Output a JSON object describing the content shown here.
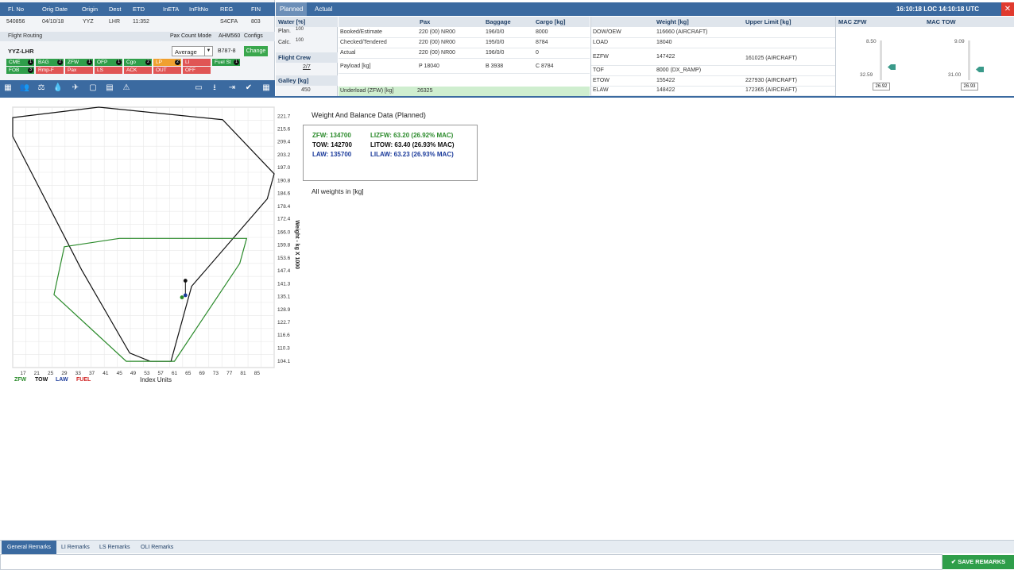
{
  "flight": {
    "headers": [
      "Fl. No",
      "Orig Date",
      "Origin",
      "Dest",
      "ETD",
      "InETA",
      "InFltNo",
      "REG",
      "FIN"
    ],
    "values": [
      "540856",
      "04/10/18",
      "YYZ",
      "LHR",
      "11:352",
      "",
      "",
      "S4CFA",
      "803"
    ],
    "routing_label": "Flight Routing",
    "pax_count_mode_label": "Pax Count Mode",
    "ahm_label": "AHM560",
    "configs_label": "Configs",
    "route": "YYZ-LHR",
    "pax_count_mode": "Average",
    "aircraft_type": "B787-8",
    "change_label": "Change"
  },
  "status_tags": [
    {
      "label": "CME",
      "num": "1",
      "color": "#2f9e4a"
    },
    {
      "label": "BAG",
      "num": "2",
      "color": "#2f9e4a"
    },
    {
      "label": "ZFW",
      "num": "1",
      "color": "#2f9e4a"
    },
    {
      "label": "OFP",
      "num": "1",
      "color": "#2f9e4a"
    },
    {
      "label": "Cgo",
      "num": "2",
      "color": "#2f9e4a"
    },
    {
      "label": "LP",
      "num": "2",
      "color": "#f0a030"
    },
    {
      "label": "LI",
      "num": "",
      "color": "#e05555"
    },
    {
      "label": "Fuel St",
      "num": "1",
      "color": "#2f9e4a"
    },
    {
      "label": "FOB",
      "num": "3",
      "color": "#2f9e4a"
    },
    {
      "label": "Rmp-F",
      "num": "",
      "color": "#e05555"
    },
    {
      "label": "Pax",
      "num": "",
      "color": "#e05555"
    },
    {
      "label": "LS",
      "num": "",
      "color": "#e05555"
    },
    {
      "label": "ACK",
      "num": "",
      "color": "#e05555"
    },
    {
      "label": "OUT",
      "num": "",
      "color": "#e05555"
    },
    {
      "label": "OFF",
      "num": "",
      "color": "#e05555"
    }
  ],
  "toolbar_icons": [
    "grid-icon",
    "users-icon",
    "scale-icon",
    "fuel-drop-icon",
    "plane-circle-icon",
    "cargo-icon",
    "table-icon",
    "trim-icon",
    "document-icon",
    "download-icon",
    "doc-out-icon",
    "checkmark-icon",
    "calculator-icon"
  ],
  "tabs": {
    "planned": "Planned",
    "actual": "Actual"
  },
  "clock": "16:10:18 LOC 14:10:18 UTC",
  "water": {
    "header": "Water [%]",
    "plan_label": "Plan.",
    "plan_value": "100",
    "calc_label": "Calc.",
    "calc_value": "100",
    "crew_header": "Flight Crew",
    "crew_value": "2/7",
    "galley_header": "Galley [kg]",
    "galley_value": "450"
  },
  "load_table": {
    "headers": [
      "Pax",
      "Baggage",
      "Cargo [kg]"
    ],
    "rows": [
      {
        "label": "Booked/Estimate",
        "pax": "220 (00) NR00",
        "bag": "196/0/0",
        "cargo": "8000"
      },
      {
        "label": "Checked/Tendered",
        "pax": "220 (00) NR00",
        "bag": "195/0/0",
        "cargo": "8784"
      },
      {
        "label": "Actual",
        "pax": "220 (00) NR00",
        "bag": "196/0/0",
        "cargo": "0"
      },
      {
        "label": "Payload [kg]",
        "pax": "P 18040",
        "bag": "B 3938",
        "cargo": "C 8784"
      }
    ],
    "underload_label": "Underload (ZFW) [kg]",
    "underload_value": "26325"
  },
  "weight_table": {
    "headers": [
      "Weight [kg]",
      "Upper Limit [kg]"
    ],
    "rows": [
      {
        "label": "DOW/OEW",
        "weight": "116660 (AIRCRAFT)",
        "limit": ""
      },
      {
        "label": "LOAD",
        "weight": "18040",
        "limit": ""
      },
      {
        "label": "EZFW",
        "weight": "147422",
        "limit": "161025 (AIRCRAFT)"
      },
      {
        "label": "TOF",
        "weight": "8000 (DX_RAMP)",
        "limit": ""
      },
      {
        "label": "ETOW",
        "weight": "155422",
        "limit": "227930 (AIRCRAFT)"
      },
      {
        "label": "ELAW",
        "weight": "148422",
        "limit": "172365 (AIRCRAFT)"
      }
    ]
  },
  "mac": {
    "zfw": {
      "title": "MAC ZFW",
      "upper": "8.50",
      "lower": "32.59",
      "value": "26.92"
    },
    "tow": {
      "title": "MAC TOW",
      "upper": "9.09",
      "lower": "31.00",
      "value": "26.93"
    }
  },
  "chart_data": {
    "type": "scatter",
    "xlabel": "Index Units",
    "ylabel": "Weight - kg X 1000",
    "x_ticks": [
      17,
      21,
      25,
      29,
      33,
      37,
      41,
      45,
      49,
      53,
      57,
      61,
      65,
      69,
      73,
      77,
      81,
      85
    ],
    "y_ticks": [
      104.1,
      110.3,
      116.6,
      122.7,
      128.9,
      135.1,
      141.3,
      147.4,
      153.6,
      159.8,
      166.0,
      172.4,
      178.4,
      184.6,
      190.8,
      197.0,
      203.2,
      209.4,
      215.6,
      221.7
    ],
    "xlim": [
      14,
      90
    ],
    "ylim": [
      101,
      226
    ],
    "envelopes": [
      {
        "name": "TOW",
        "color": "#111111",
        "points": [
          [
            14,
            221
          ],
          [
            39,
            226
          ],
          [
            75,
            220
          ],
          [
            90,
            194
          ],
          [
            88,
            182
          ],
          [
            66,
            140
          ],
          [
            60,
            104
          ],
          [
            54,
            104
          ],
          [
            48,
            108
          ],
          [
            34,
            148
          ],
          [
            14,
            212
          ]
        ]
      },
      {
        "name": "ZFW",
        "color": "#2a8a2a",
        "points": [
          [
            29,
            159
          ],
          [
            45,
            163
          ],
          [
            82,
            163
          ],
          [
            80,
            151
          ],
          [
            61,
            104
          ],
          [
            47,
            104
          ],
          [
            26,
            136
          ],
          [
            29,
            159
          ]
        ]
      }
    ],
    "points": [
      {
        "name": "TOW",
        "x": 64.2,
        "y": 142.7,
        "color": "#111111"
      },
      {
        "name": "LAW",
        "x": 64.2,
        "y": 135.7,
        "color": "#1a3a9a"
      },
      {
        "name": "ZFW",
        "x": 63.2,
        "y": 134.7,
        "color": "#2a8a2a"
      }
    ],
    "legend": [
      {
        "label": "ZFW",
        "color": "#2a8a2a"
      },
      {
        "label": "TOW",
        "color": "#111111"
      },
      {
        "label": "LAW",
        "color": "#1a3a9a"
      },
      {
        "label": "FUEL",
        "color": "#d02020"
      }
    ]
  },
  "wb": {
    "title": "Weight And Balance Data (Planned)",
    "zfw": "ZFW: 134700",
    "lizfw": "LIZFW: 63.20 (26.92% MAC)",
    "tow": "TOW: 142700",
    "litow": "LITOW: 63.40 (26.93% MAC)",
    "law": "LAW: 135700",
    "lilaw": "LILAW: 63.23 (26.93% MAC)",
    "units_note": "All weights in [kg]"
  },
  "remarks": {
    "tabs": [
      "General Remarks",
      "LI Remarks",
      "LS Remarks",
      "OLI Remarks"
    ],
    "save_label": "SAVE REMARKS"
  },
  "colors": {
    "accent": "#3b6aa0",
    "green": "#2f9e4a",
    "red": "#e03a2e"
  }
}
